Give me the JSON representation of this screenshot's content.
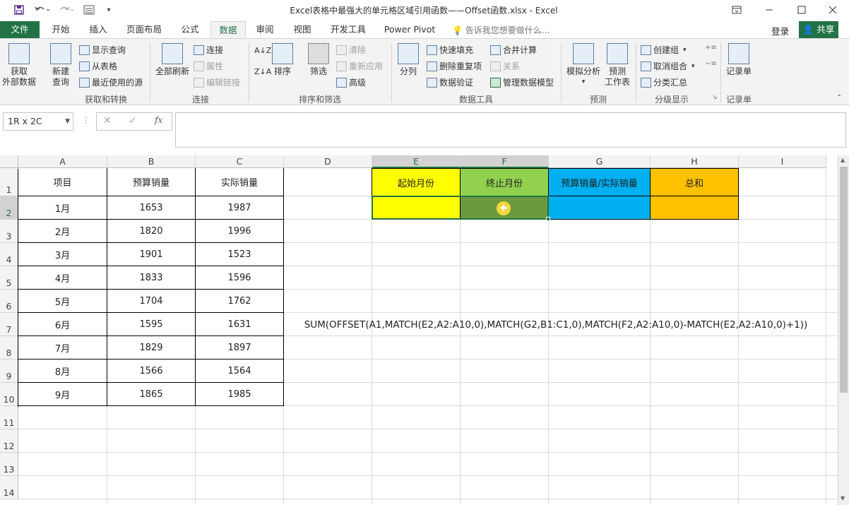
{
  "window": {
    "title": "Excel表格中最强大的单元格区域引用函数——Offset函数.xlsx - Excel",
    "controls": [
      "ribbon-display-icon",
      "minimize-icon",
      "maximize-icon",
      "close-icon"
    ]
  },
  "tabs": {
    "file": "文件",
    "items": [
      "开始",
      "插入",
      "页面布局",
      "公式",
      "数据",
      "审阅",
      "视图",
      "开发工具",
      "Power Pivot"
    ],
    "active": "数据",
    "tell_me": "告诉我您想要做什么...",
    "login": "登录",
    "share": "共享"
  },
  "ribbon": {
    "get_transform": {
      "get_external": "获取\n外部数据",
      "new_query": "新建\n查询",
      "show_queries": "显示查询",
      "from_table": "从表格",
      "recent_sources": "最近使用的源",
      "label": "获取和转换"
    },
    "connections": {
      "refresh_all": "全部刷新",
      "connections": "连接",
      "properties": "属性",
      "edit_links": "编辑链接",
      "label": "连接"
    },
    "sort_filter": {
      "sort": "排序",
      "filter": "筛选",
      "clear": "清除",
      "reapply": "重新应用",
      "advanced": "高级",
      "label": "排序和筛选"
    },
    "data_tools": {
      "text_to_columns": "分列",
      "flash_fill": "快速填充",
      "remove_duplicates": "删除重复项",
      "data_validation": "数据验证",
      "consolidate": "合并计算",
      "relationships": "关系",
      "manage_model": "管理数据模型",
      "label": "数据工具"
    },
    "forecast": {
      "what_if": "模拟分析",
      "forecast_sheet": "预测\n工作表",
      "label": "预测"
    },
    "outline": {
      "group": "创建组",
      "ungroup": "取消组合",
      "subtotal": "分类汇总",
      "label": "分级显示"
    },
    "records": {
      "record_form": "记录单",
      "label": "记录单"
    }
  },
  "formula_bar": {
    "name_box": "1R x 2C",
    "formula": ""
  },
  "sheet": {
    "columns": [
      "A",
      "B",
      "C",
      "D",
      "E",
      "F",
      "G",
      "H",
      "I"
    ],
    "rows": [
      "1",
      "2",
      "3",
      "4",
      "5",
      "6",
      "7",
      "8",
      "9",
      "10",
      "11",
      "12",
      "13",
      "14"
    ],
    "table_headers": [
      "项目",
      "预算销量",
      "实际销量"
    ],
    "table_rows": [
      [
        "1月",
        "1653",
        "1987"
      ],
      [
        "2月",
        "1820",
        "1996"
      ],
      [
        "3月",
        "1901",
        "1523"
      ],
      [
        "4月",
        "1833",
        "1596"
      ],
      [
        "5月",
        "1704",
        "1762"
      ],
      [
        "6月",
        "1595",
        "1631"
      ],
      [
        "7月",
        "1829",
        "1897"
      ],
      [
        "8月",
        "1566",
        "1564"
      ],
      [
        "9月",
        "1865",
        "1985"
      ]
    ],
    "query_headers": {
      "start_month": "起始月份",
      "end_month": "终止月份",
      "budget_actual": "预算销量/实际销量",
      "total": "总和"
    },
    "formula_note": "SUM(OFFSET(A1,MATCH(E2,A2:A10,0),MATCH(G2,B1:C1,0),MATCH(F2,A2:A10,0)-MATCH(E2,A2:A10,0)+1))",
    "colors": {
      "yellow": "#ffff00",
      "green": "#92d050",
      "green_selected": "#6a9a3c",
      "blue": "#00b0f0",
      "orange": "#ffc000",
      "excel_green": "#217346"
    }
  }
}
